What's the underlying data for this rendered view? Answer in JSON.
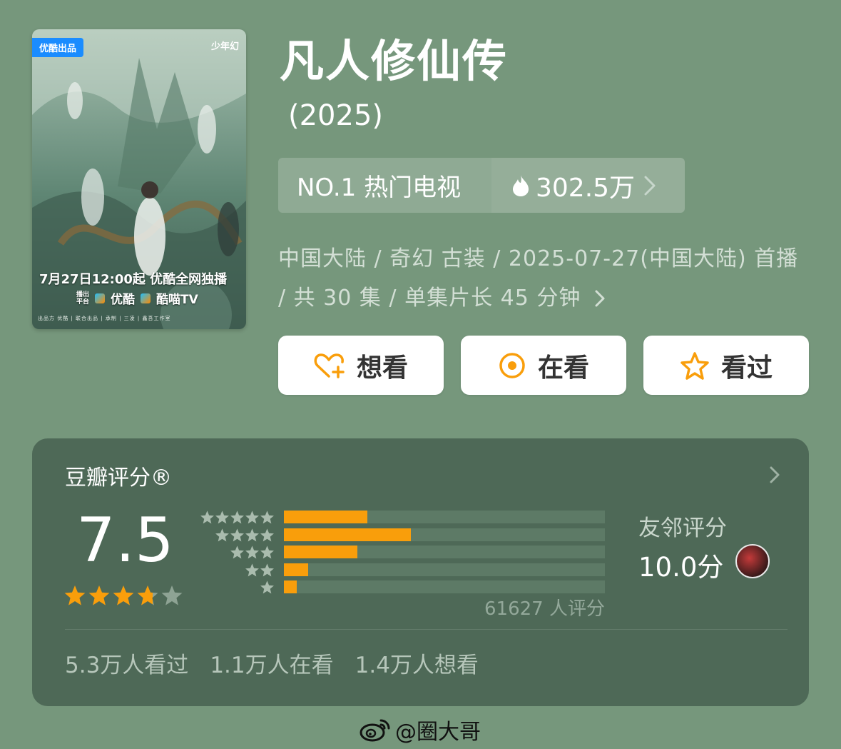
{
  "poster": {
    "tag": "优酷出品",
    "brand": "少年幻",
    "release": "7月27日12:00起 优酷全网独播",
    "platform_prefix": "播出\n平台",
    "platform_1": "优酷",
    "platform_2": "酷喵TV",
    "credits": "出品方  优酷  |  联合出品  |  承制  |  三凌  |  鑫吾工作室"
  },
  "title": "凡人修仙传",
  "year": "(2025)",
  "rank": {
    "label": "NO.1 热门电视",
    "heat": "302.5万"
  },
  "meta": {
    "text": "中国大陆 / 奇幻 古装 / 2025-07-27(中国大陆) 首播 / 共 30 集 / 单集片长 45 分钟"
  },
  "actions": {
    "want": "想看",
    "watching": "在看",
    "watched": "看过"
  },
  "rating": {
    "title": "豆瓣评分®",
    "score": "7.5",
    "stars": 3.75,
    "distribution": [
      0.26,
      0.395,
      0.228,
      0.075,
      0.04
    ],
    "votes": "61627 人评分",
    "friend_label": "友邻评分",
    "friend_score": "10.0分"
  },
  "stats": {
    "watched": "5.3万人看过",
    "watching": "1.1万人在看",
    "want": "1.4万人想看"
  },
  "watermark": "@圈大哥",
  "colors": {
    "background": "#76977c",
    "card": "#4e6957",
    "accent": "#f99e0b"
  }
}
